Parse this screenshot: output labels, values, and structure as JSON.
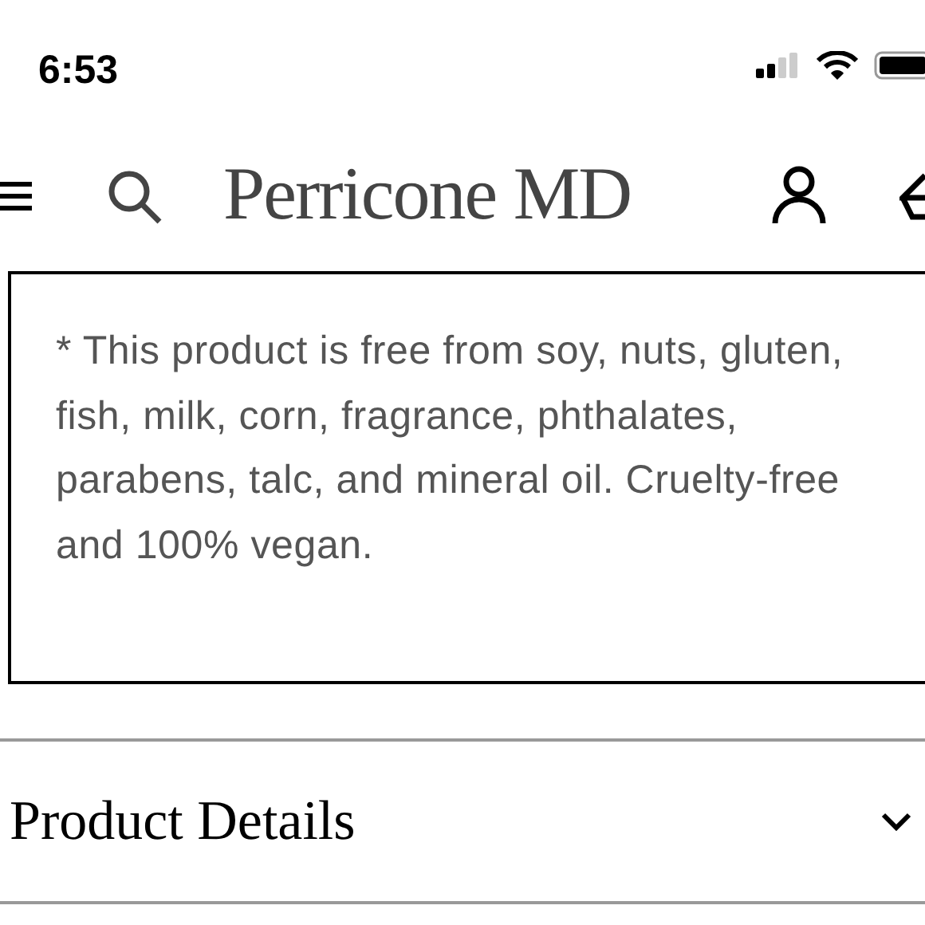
{
  "status_bar": {
    "time": "6:53"
  },
  "header": {
    "logo": "Perricone MD"
  },
  "notice": {
    "text": "* This product is free from soy, nuts, gluten, fish, milk, corn, fragrance, phthalates, parabens, talc, and mineral oil. Cruelty-free and 100% vegan."
  },
  "sections": [
    {
      "title": "Product Details",
      "expanded": false
    }
  ]
}
